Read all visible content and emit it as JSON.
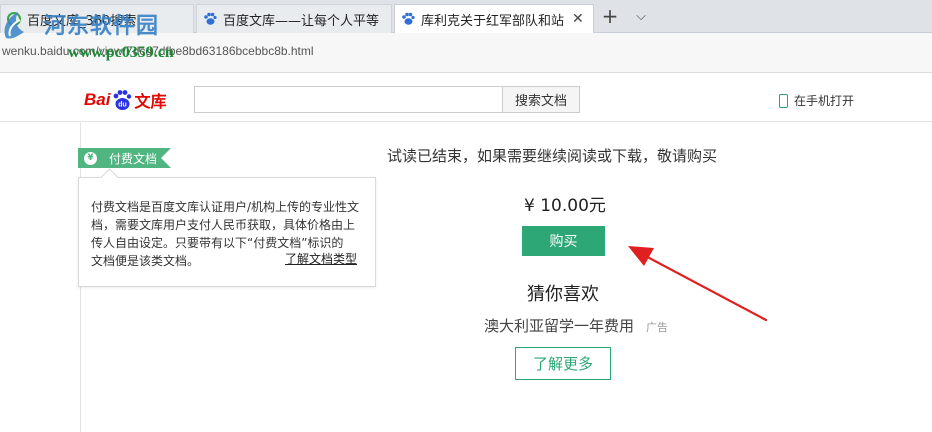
{
  "browser": {
    "tabs": [
      {
        "title": "百度文库_360搜索",
        "favicon": "360-icon",
        "active": false
      },
      {
        "title": "百度文库——让每个人平等",
        "favicon": "baidu-paw-icon",
        "active": false
      },
      {
        "title": "库利克关于红军部队和站",
        "favicon": "baidu-paw-icon",
        "active": true
      }
    ],
    "close_glyph": "✕",
    "new_tab_glyph": "+",
    "more_glyph": "⌵",
    "url": "wenku.baidu.com/view/7dcd7dfbe8bd63186bcebbc8b.html"
  },
  "watermark": {
    "site_name": "河东软件园",
    "site_url": "www.pc0359.cn"
  },
  "header": {
    "logo_bai": "Bai",
    "logo_du": "du",
    "logo_wenku": "文库",
    "search_placeholder": "",
    "search_button": "搜索文档",
    "mobile_open": "在手机打开"
  },
  "paid_doc": {
    "badge_label": "付费文档",
    "yen_glyph": "¥",
    "tooltip_lines": [
      "付费文档是百度文库认证用户/机构上传的专业性文",
      "档，需要文库用户支付人民币获取，具体价格由上",
      "传人自由设定。只要带有以下“付费文档”标识的",
      "文档便是该类文档。"
    ],
    "tooltip_link": "了解文档类型"
  },
  "purchase": {
    "trial_message": "试读已结束，如果需要继续阅读或下载，敬请购买",
    "price": "¥ 10.00元",
    "buy_button": "购买"
  },
  "recommend": {
    "title": "猜你喜欢",
    "ad_text": "澳大利亚留学一年费用",
    "ad_tag": "广告",
    "more_button": "了解更多"
  },
  "colors": {
    "brand_red": "#e10602",
    "accent_green": "#2ea777",
    "badge_green": "#50b581",
    "arrow_red": "#e02020"
  }
}
